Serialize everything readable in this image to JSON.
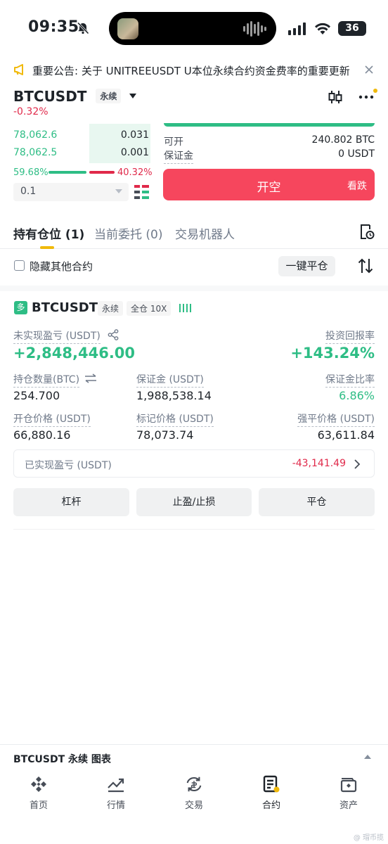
{
  "status": {
    "time": "09:35",
    "battery": "36"
  },
  "notice": {
    "text": "重要公告: 关于 UNITREEUSDT U本位永续合约资金费率的重要更新（..."
  },
  "header": {
    "symbol": "BTCUSDT",
    "contract_tag": "永续",
    "change": "-0.32%"
  },
  "orderbook": {
    "rows": [
      {
        "price": "78,062.6",
        "qty": "0.031"
      },
      {
        "price": "78,062.5",
        "qty": "0.001"
      }
    ],
    "buy_ratio": "59.68%",
    "sell_ratio": "40.32%",
    "buy_fraction": 0.5968,
    "precision": "0.1"
  },
  "order": {
    "available_label": "可开",
    "available_value": "240.802 BTC",
    "margin_label": "保证金",
    "margin_value": "0 USDT",
    "short_button": "开空",
    "short_hint": "看跌"
  },
  "tabs": [
    {
      "label": "持有仓位 (1)"
    },
    {
      "label": "当前委托 (0)"
    },
    {
      "label": "交易机器人"
    }
  ],
  "filter": {
    "hide_label": "隐藏其他合约",
    "close_all": "一键平仓"
  },
  "position": {
    "side_badge": "多",
    "symbol": "BTCUSDT",
    "contract_tag": "永续",
    "mode_tag": "全仓 10X",
    "pnl_label": "未实现盈亏 (USDT)",
    "pnl_value": "+2,848,446.00",
    "roi_label": "投资回报率",
    "roi_value": "+143.24%",
    "size_label": "持仓数量(BTC)",
    "size_value": "254.700",
    "margin_label": "保证金 (USDT)",
    "margin_value": "1,988,538.14",
    "margin_ratio_label": "保证金比率",
    "margin_ratio_value": "6.86%",
    "entry_label": "开仓价格 (USDT)",
    "entry_value": "66,880.16",
    "mark_label": "标记价格 (USDT)",
    "mark_value": "78,073.74",
    "liq_label": "强平价格 (USDT)",
    "liq_value": "63,611.84",
    "realized_label": "已实现盈亏 (USDT)",
    "realized_value": "-43,141.49",
    "btn_leverage": "杠杆",
    "btn_tpsl": "止盈/止损",
    "btn_close": "平仓"
  },
  "chart_bar": {
    "label": "BTCUSDT 永续 图表"
  },
  "nav": [
    {
      "label": "首页"
    },
    {
      "label": "行情"
    },
    {
      "label": "交易"
    },
    {
      "label": "合约"
    },
    {
      "label": "资产"
    }
  ],
  "watermark": "@ 瑁币揽"
}
